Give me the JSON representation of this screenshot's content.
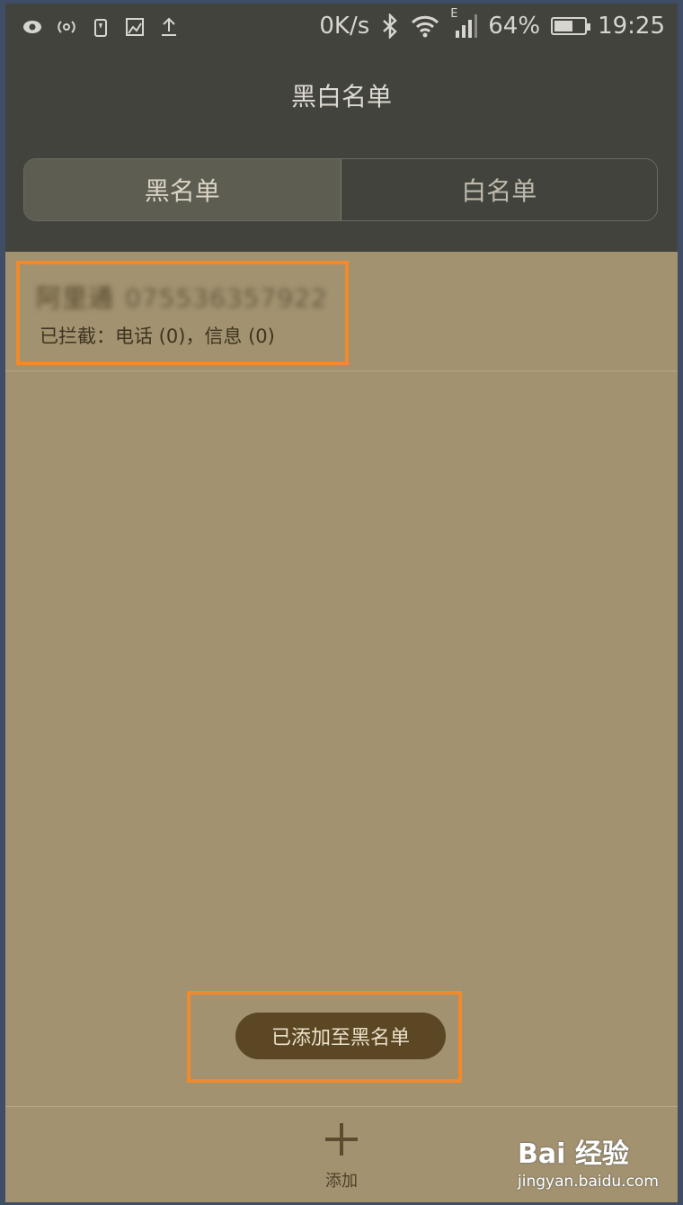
{
  "status_bar": {
    "speed": "0K/s",
    "network": "E",
    "battery_percent": "64%",
    "battery_level": 0.64,
    "time": "19:25"
  },
  "header": {
    "title": "黑白名单",
    "tabs": [
      {
        "label": "黑名单",
        "active": true
      },
      {
        "label": "白名单",
        "active": false
      }
    ]
  },
  "list": {
    "items": [
      {
        "name": "阿里通",
        "number": "075536357922",
        "blocked_text": "已拦截：电话 (0)，信息 (0)"
      }
    ]
  },
  "toast": {
    "text": "已添加至黑名单"
  },
  "bottom_bar": {
    "add_label": "添加"
  },
  "watermark": {
    "logo": "Bai 经验",
    "url": "jingyan.baidu.com"
  },
  "colors": {
    "highlight": "#f08a2c",
    "content_bg": "#a29270",
    "header_bg": "#43433d"
  }
}
